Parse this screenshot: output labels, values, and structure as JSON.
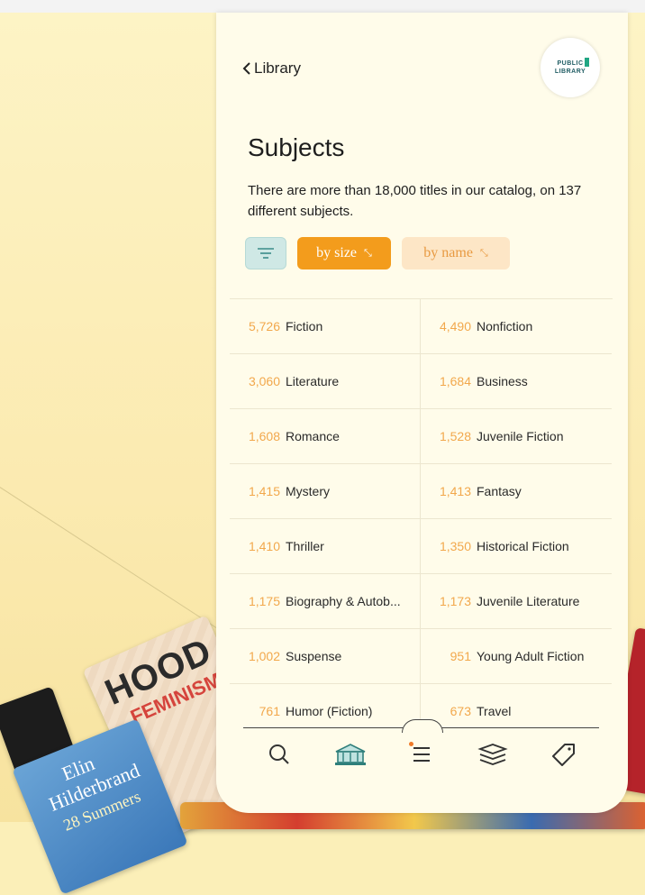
{
  "header": {
    "back_label": "Library",
    "logo_line1": "PUBLIC",
    "logo_line2": "LIBRARY"
  },
  "page": {
    "title": "Subjects",
    "description": "There are more than 18,000 titles in our catalog, on 137 different subjects."
  },
  "sort": {
    "by_size": "by size",
    "by_name": "by name",
    "active": "by size"
  },
  "subjects": [
    {
      "count": "5,726",
      "name": "Fiction"
    },
    {
      "count": "4,490",
      "name": "Nonfiction"
    },
    {
      "count": "3,060",
      "name": "Literature"
    },
    {
      "count": "1,684",
      "name": "Business"
    },
    {
      "count": "1,608",
      "name": "Romance"
    },
    {
      "count": "1,528",
      "name": "Juvenile Fiction"
    },
    {
      "count": "1,415",
      "name": "Mystery"
    },
    {
      "count": "1,413",
      "name": "Fantasy"
    },
    {
      "count": "1,410",
      "name": "Thriller"
    },
    {
      "count": "1,350",
      "name": "Historical Fiction"
    },
    {
      "count": "1,175",
      "name": "Biography & Autob..."
    },
    {
      "count": "1,173",
      "name": "Juvenile Literature"
    },
    {
      "count": "1,002",
      "name": "Suspense"
    },
    {
      "count": "951",
      "name": "Young Adult Fiction"
    },
    {
      "count": "761",
      "name": "Humor (Fiction)"
    },
    {
      "count": "673",
      "name": "Travel"
    }
  ],
  "background_books": {
    "hood_title": "HOOD",
    "hood_subtitle": "FEMINISM",
    "elin_line1": "Elin",
    "elin_line2": "Hilderbrand",
    "elin_line3": "28 Summers"
  },
  "nav": [
    {
      "icon": "search-icon"
    },
    {
      "icon": "library-icon"
    },
    {
      "icon": "menu-icon"
    },
    {
      "icon": "stack-icon"
    },
    {
      "icon": "tag-icon"
    }
  ],
  "colors": {
    "accent": "#f39c1c",
    "panel": "#fffcea",
    "filter": "#cfe8e5"
  }
}
